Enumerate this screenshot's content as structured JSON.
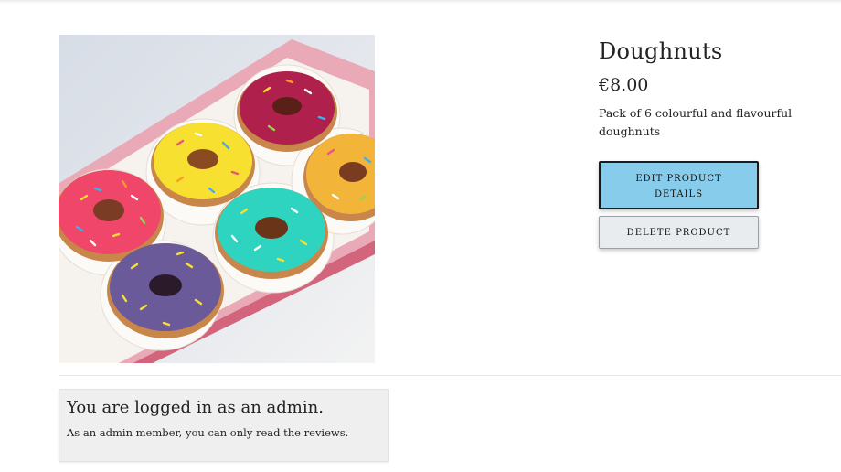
{
  "product": {
    "title": "Doughnuts",
    "price": "€8.00",
    "description": "Pack of 6 colourful and flavourful doughnuts",
    "image_alt": "Box of six colourful sprinkled doughnuts"
  },
  "actions": {
    "edit_label": "Edit Product Details",
    "delete_label": "Delete Product"
  },
  "admin_notice": {
    "heading": "You are logged in as an admin.",
    "text": "As an admin member, you can only read the reviews."
  },
  "colors": {
    "edit_button": "#88ccec",
    "delete_button": "#e8ecef",
    "notice_background": "#efefef"
  }
}
